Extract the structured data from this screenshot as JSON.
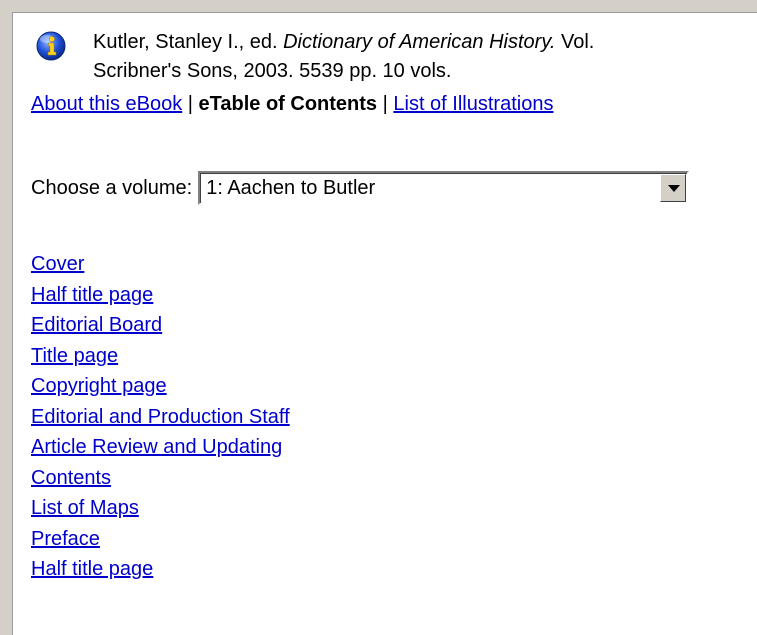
{
  "citation": {
    "author": "Kutler, Stanley I., ed. ",
    "title": "Dictionary of American History.",
    "after_title": " Vol.",
    "line2": "Scribner's Sons, 2003. 5539 pp. 10 vols."
  },
  "nav": {
    "about": "About this eBook",
    "sep1": " | ",
    "current": "eTable of Contents",
    "sep2": " | ",
    "illustrations": "List of Illustrations"
  },
  "volume": {
    "label": "Choose a volume:",
    "selected": "1: Aachen to Butler"
  },
  "toc": [
    "Cover",
    "Half title page",
    "Editorial Board",
    "Title page",
    "Copyright page",
    "Editorial and Production Staff",
    "Article Review and Updating",
    "Contents",
    "List of Maps",
    "Preface",
    "Half title page"
  ],
  "colors": {
    "link": "#0000cc",
    "background": "#ffffff",
    "chrome": "#d4d0c8"
  },
  "icons": {
    "info": "info-icon"
  }
}
